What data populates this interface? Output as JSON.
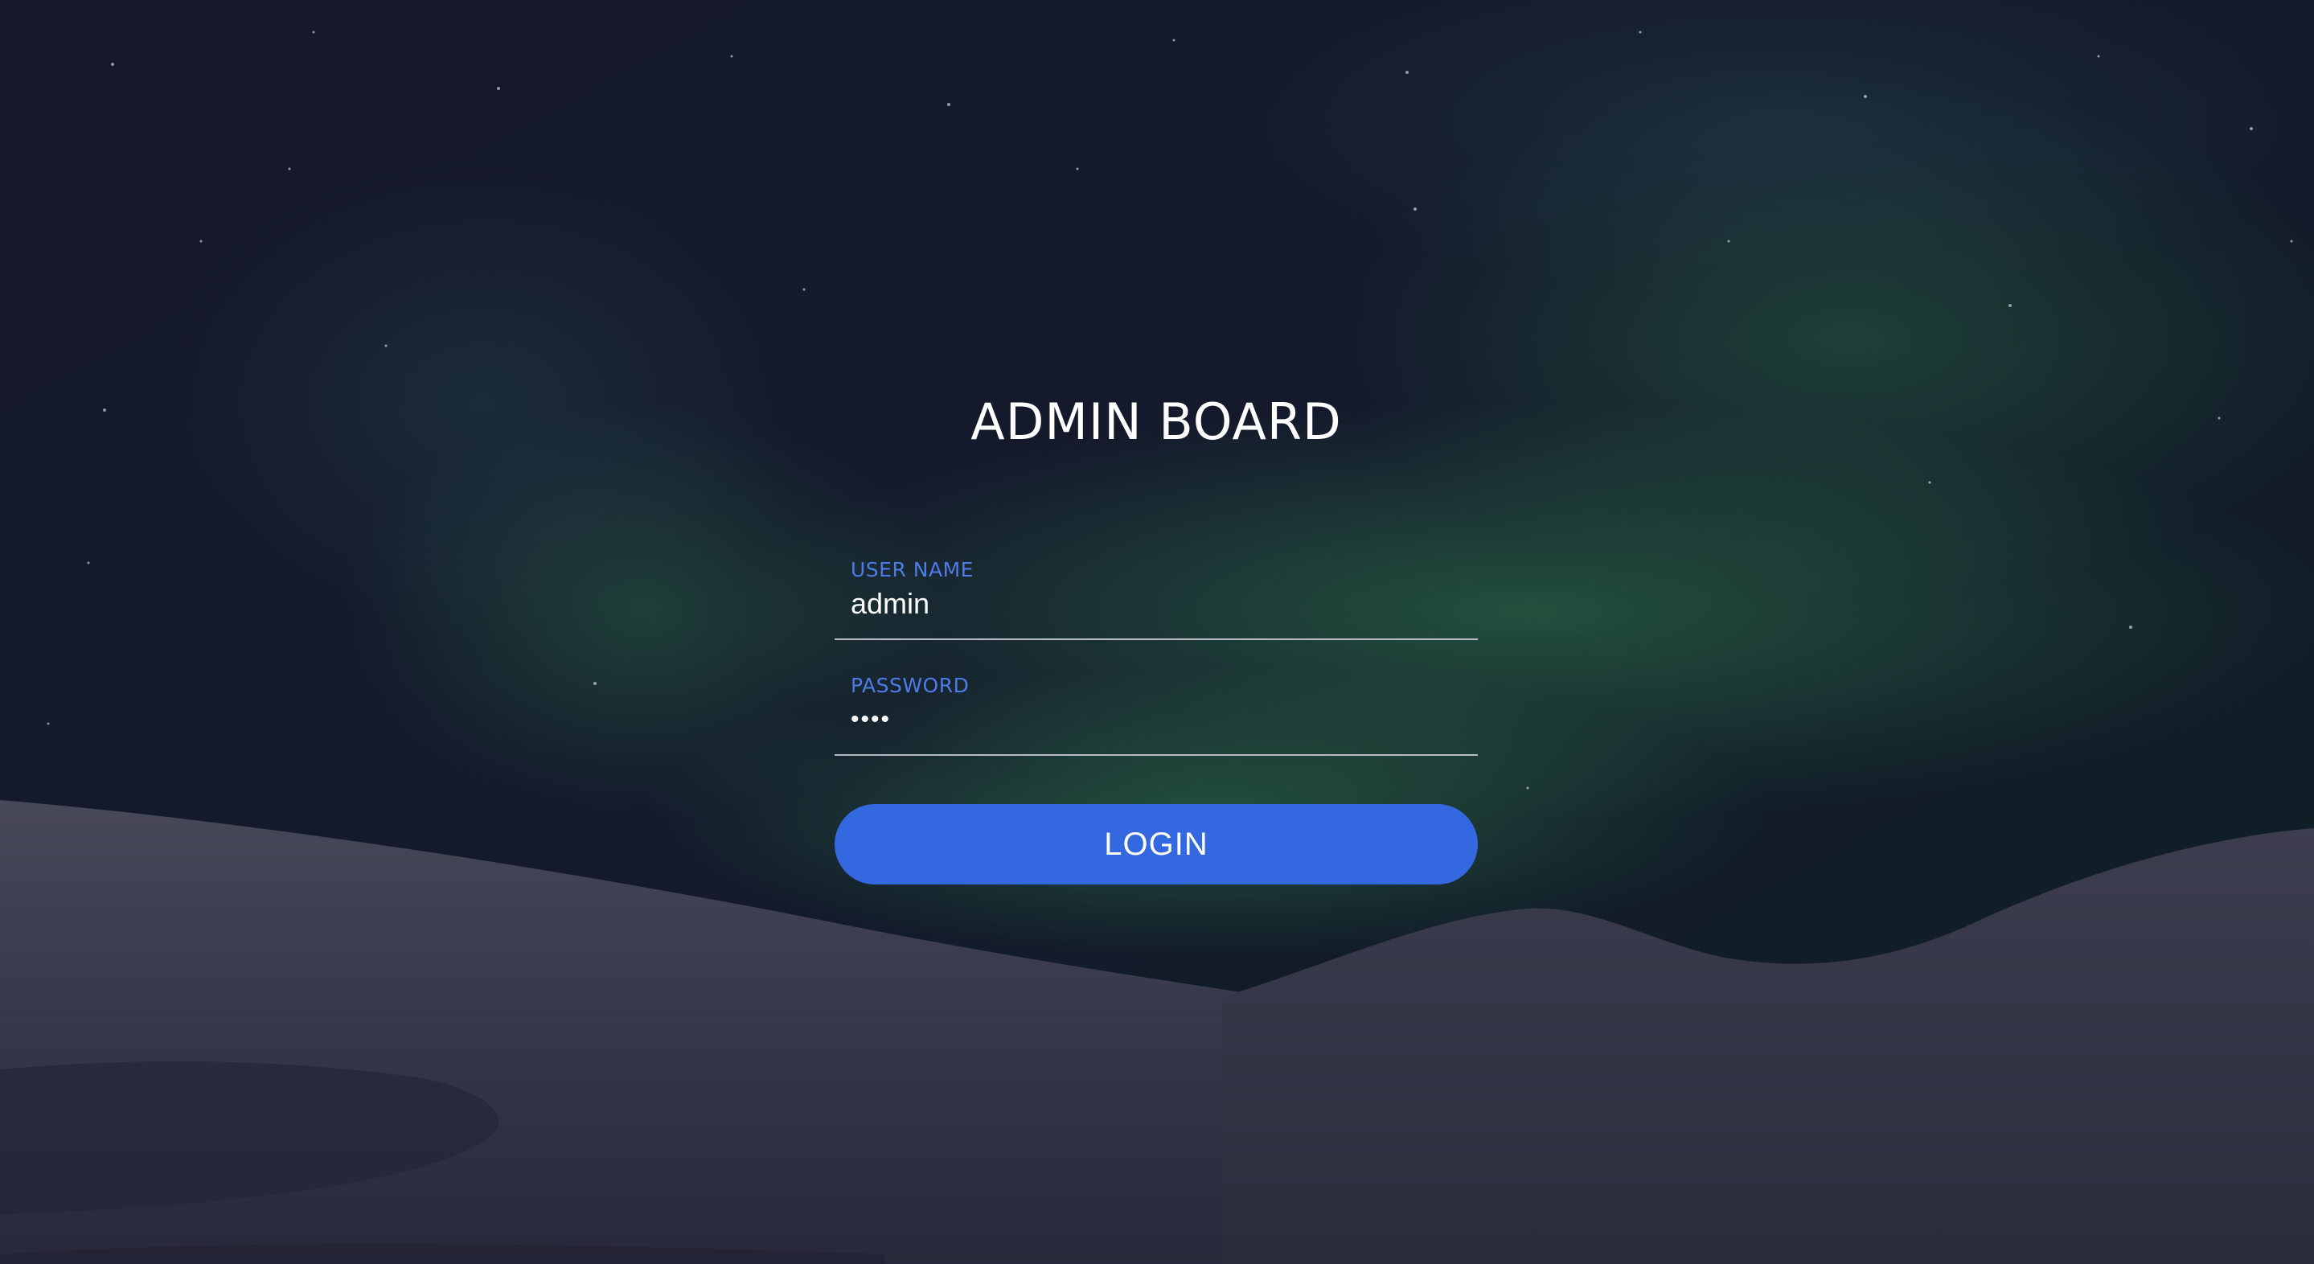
{
  "login": {
    "title": "ADMIN BOARD",
    "username_label": "USER NAME",
    "username_value": "admin",
    "password_label": "PASSWORD",
    "password_value": "••••",
    "login_label": "LOGIN"
  },
  "colors": {
    "accent": "#3468e0",
    "label": "#4f7be6",
    "underline": "#b7bcc6",
    "sky": "#13182b",
    "aurora": "#1f5a3c",
    "snow": "#3a3c4d"
  }
}
